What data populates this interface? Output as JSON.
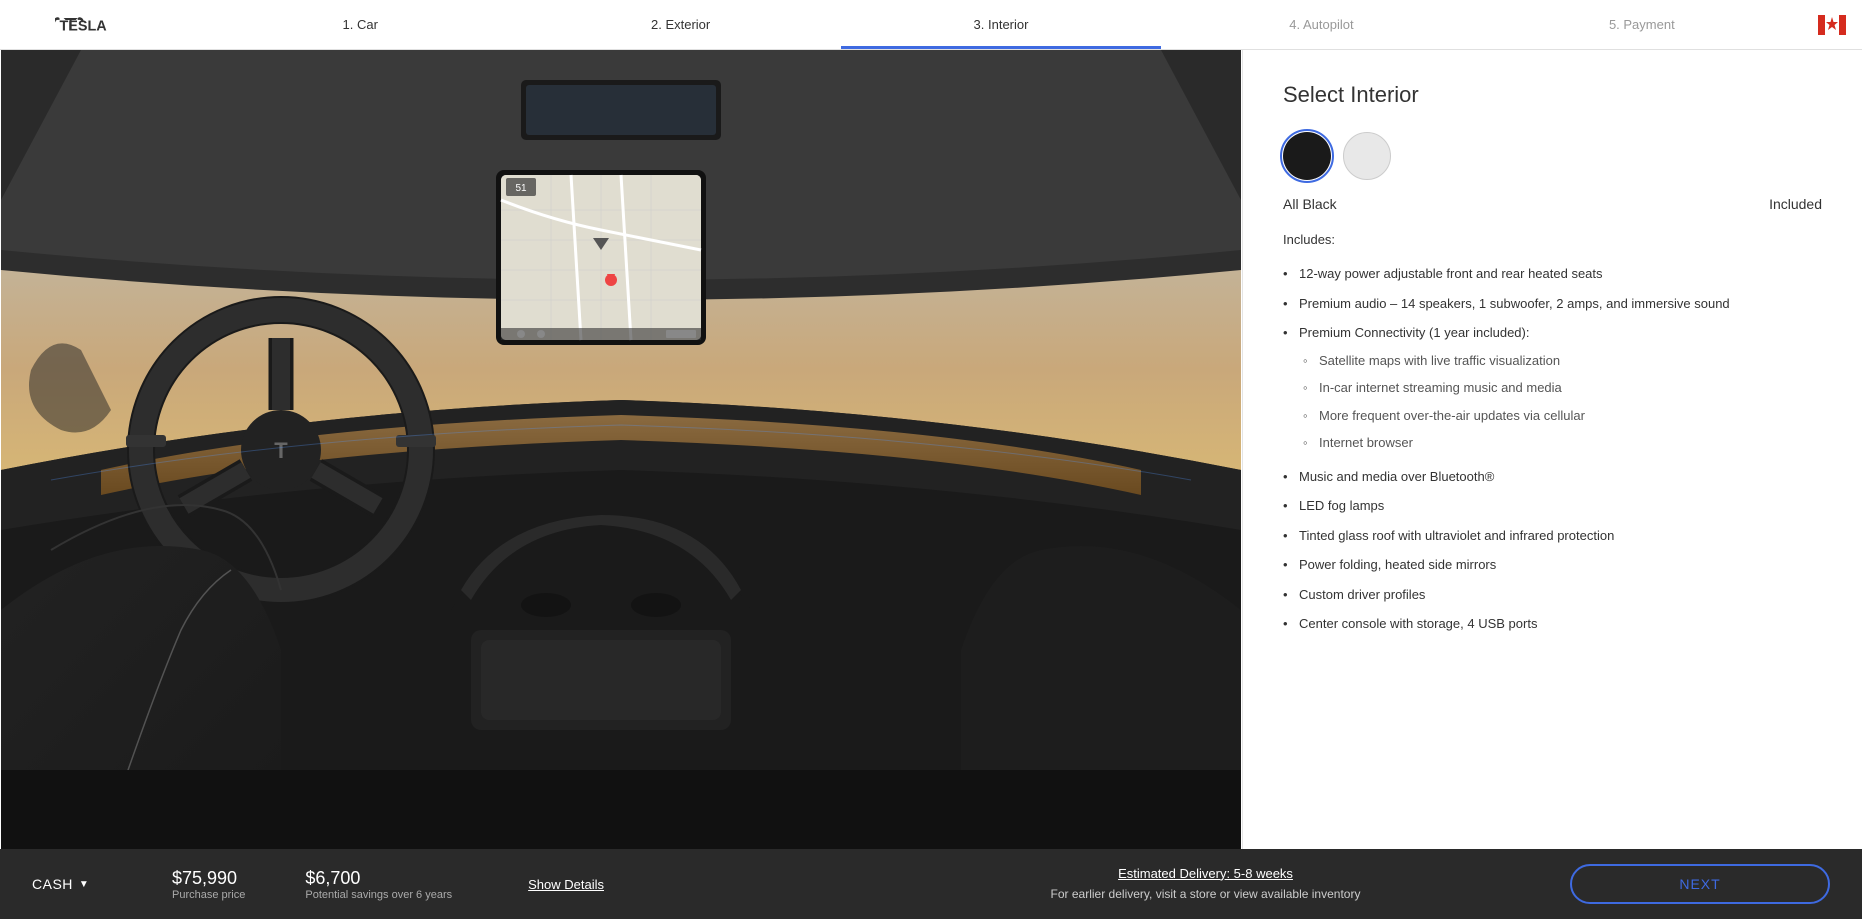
{
  "header": {
    "logo_alt": "Tesla",
    "nav": [
      {
        "label": "1. Car",
        "active": false,
        "inactive": false
      },
      {
        "label": "2. Exterior",
        "active": false,
        "inactive": false
      },
      {
        "label": "3. Interior",
        "active": true,
        "inactive": false
      },
      {
        "label": "4. Autopilot",
        "active": false,
        "inactive": true
      },
      {
        "label": "5. Payment",
        "active": false,
        "inactive": true
      }
    ]
  },
  "right_panel": {
    "title": "Select Interior",
    "swatches": [
      {
        "name": "All Black",
        "type": "black",
        "selected": true
      },
      {
        "name": "White",
        "type": "white",
        "selected": false
      }
    ],
    "selected_color": "All Black",
    "selected_price": "Included",
    "includes_label": "Includes:",
    "features": [
      {
        "text": "12-way power adjustable front and rear heated seats",
        "sub": []
      },
      {
        "text": "Premium audio – 14 speakers, 1 subwoofer, 2 amps, and immersive sound",
        "sub": []
      },
      {
        "text": "Premium Connectivity (1 year included):",
        "sub": [
          "Satellite maps with live traffic visualization",
          "In-car internet streaming music and media",
          "More frequent over-the-air updates via cellular",
          "Internet browser"
        ]
      },
      {
        "text": "Music and media over Bluetooth®",
        "sub": []
      },
      {
        "text": "LED fog lamps",
        "sub": []
      },
      {
        "text": "Tinted glass roof with ultraviolet and infrared protection",
        "sub": []
      },
      {
        "text": "Power folding, heated side mirrors",
        "sub": []
      },
      {
        "text": "Custom driver profiles",
        "sub": []
      },
      {
        "text": "Center console with storage, 4 USB ports",
        "sub": []
      }
    ]
  },
  "bottom_bar": {
    "payment_type": "CASH",
    "purchase_price": "$75,990",
    "purchase_label": "Purchase price",
    "savings_amount": "$6,700",
    "savings_label": "Potential savings over 6 years",
    "show_details": "Show Details",
    "delivery_link": "Estimated Delivery: 5-8 weeks",
    "delivery_text": "For earlier delivery, visit a store or view available inventory",
    "next_label": "NEXT"
  }
}
